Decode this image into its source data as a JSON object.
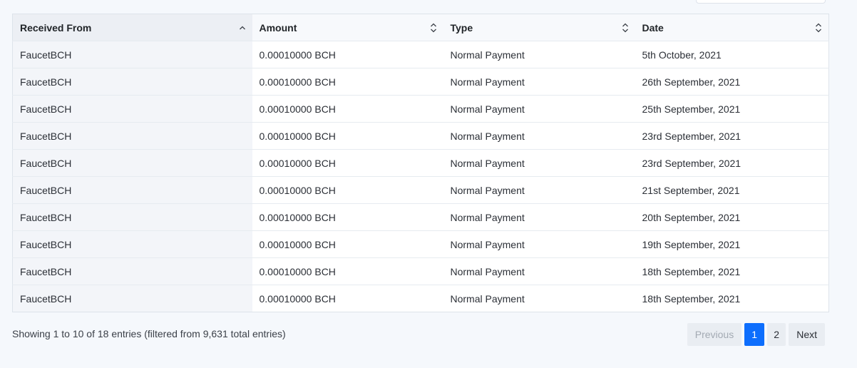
{
  "table": {
    "columns": [
      {
        "label": "Received From",
        "sort": "asc"
      },
      {
        "label": "Amount",
        "sort": "none"
      },
      {
        "label": "Type",
        "sort": "none"
      },
      {
        "label": "Date",
        "sort": "none"
      }
    ],
    "rows": [
      [
        "FaucetBCH",
        "0.00010000 BCH",
        "Normal Payment",
        "5th October, 2021"
      ],
      [
        "FaucetBCH",
        "0.00010000 BCH",
        "Normal Payment",
        "26th September, 2021"
      ],
      [
        "FaucetBCH",
        "0.00010000 BCH",
        "Normal Payment",
        "25th September, 2021"
      ],
      [
        "FaucetBCH",
        "0.00010000 BCH",
        "Normal Payment",
        "23rd September, 2021"
      ],
      [
        "FaucetBCH",
        "0.00010000 BCH",
        "Normal Payment",
        "23rd September, 2021"
      ],
      [
        "FaucetBCH",
        "0.00010000 BCH",
        "Normal Payment",
        "21st September, 2021"
      ],
      [
        "FaucetBCH",
        "0.00010000 BCH",
        "Normal Payment",
        "20th September, 2021"
      ],
      [
        "FaucetBCH",
        "0.00010000 BCH",
        "Normal Payment",
        "19th September, 2021"
      ],
      [
        "FaucetBCH",
        "0.00010000 BCH",
        "Normal Payment",
        "18th September, 2021"
      ],
      [
        "FaucetBCH",
        "0.00010000 BCH",
        "Normal Payment",
        "18th September, 2021"
      ]
    ]
  },
  "info": "Showing 1 to 10 of 18 entries (filtered from 9,631 total entries)",
  "pagination": {
    "previous_label": "Previous",
    "next_label": "Next",
    "pages": [
      "1",
      "2"
    ],
    "current_page": "1"
  },
  "colors": {
    "accent": "#0d6efd"
  }
}
